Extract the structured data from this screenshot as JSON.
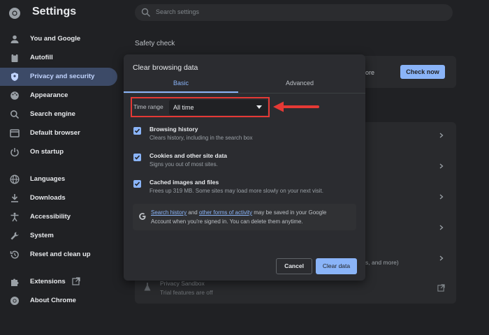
{
  "header": {
    "title": "Settings",
    "search_placeholder": "Search settings"
  },
  "sidebar": {
    "items": [
      {
        "label": "You and Google",
        "icon": "person-icon"
      },
      {
        "label": "Autofill",
        "icon": "clipboard-icon"
      },
      {
        "label": "Privacy and security",
        "icon": "shield-icon",
        "active": true
      },
      {
        "label": "Appearance",
        "icon": "palette-icon"
      },
      {
        "label": "Search engine",
        "icon": "search-icon"
      },
      {
        "label": "Default browser",
        "icon": "browser-icon"
      },
      {
        "label": "On startup",
        "icon": "power-icon"
      },
      {
        "label": "Languages",
        "icon": "globe-icon"
      },
      {
        "label": "Downloads",
        "icon": "download-icon"
      },
      {
        "label": "Accessibility",
        "icon": "accessibility-icon"
      },
      {
        "label": "System",
        "icon": "wrench-icon"
      },
      {
        "label": "Reset and clean up",
        "icon": "history-icon"
      },
      {
        "label": "Extensions",
        "icon": "puzzle-icon"
      },
      {
        "label": "About Chrome",
        "icon": "chrome-icon"
      }
    ]
  },
  "main": {
    "safety_heading": "Safety check",
    "check_now_label": "Check now",
    "peek_more": "ore",
    "peek_and_more": "s, and more)",
    "privacy_sandbox_title": "Privacy Sandbox",
    "privacy_sandbox_desc": "Trial features are off"
  },
  "dialog": {
    "title": "Clear browsing data",
    "tabs": [
      "Basic",
      "Advanced"
    ],
    "active_tab": "Basic",
    "time_range_label": "Time range",
    "time_range_value": "All time",
    "options": [
      {
        "title": "Browsing history",
        "desc": "Clears history, including in the search box",
        "checked": true
      },
      {
        "title": "Cookies and other site data",
        "desc": "Signs you out of most sites.",
        "checked": true
      },
      {
        "title": "Cached images and files",
        "desc": "Frees up 319 MB. Some sites may load more slowly on your next visit.",
        "checked": true
      }
    ],
    "google_note": {
      "link1": "Search history",
      "mid1": "and",
      "link2": "other forms of activity",
      "rest_line1": "may be saved in your Google",
      "line2": "Account when you're signed in. You can delete them anytime."
    },
    "cancel_label": "Cancel",
    "clear_label": "Clear data"
  },
  "colors": {
    "accent": "#8ab4f8",
    "highlight": "#e53935",
    "background": "#202124",
    "dialog": "#2b2c30"
  }
}
